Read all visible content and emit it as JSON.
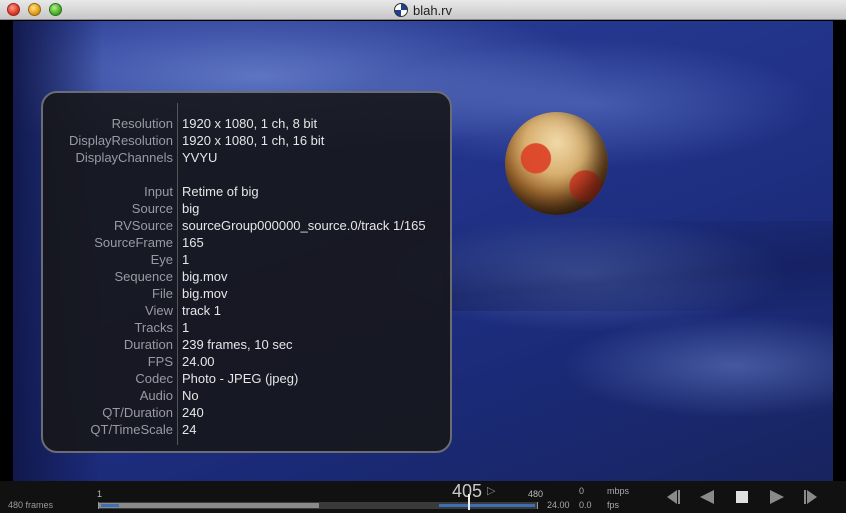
{
  "window": {
    "title": "blah.rv"
  },
  "info": {
    "rows": [
      {
        "label": "Resolution",
        "value": "1920 x 1080, 1 ch, 8 bit"
      },
      {
        "label": "DisplayResolution",
        "value": "1920 x 1080, 1 ch, 16 bit"
      },
      {
        "label": "DisplayChannels",
        "value": "YVYU"
      },
      {
        "label": "Input",
        "value": "Retime of big"
      },
      {
        "label": "Source",
        "value": "big"
      },
      {
        "label": "RVSource",
        "value": "sourceGroup000000_source.0/track 1/165"
      },
      {
        "label": "SourceFrame",
        "value": "165"
      },
      {
        "label": "Eye",
        "value": "1"
      },
      {
        "label": "Sequence",
        "value": "big.mov"
      },
      {
        "label": "File",
        "value": "big.mov"
      },
      {
        "label": "View",
        "value": "track 1"
      },
      {
        "label": "Tracks",
        "value": "1"
      },
      {
        "label": "Duration",
        "value": "239 frames, 10 sec"
      },
      {
        "label": "FPS",
        "value": "24.00"
      },
      {
        "label": "Codec",
        "value": "Photo - JPEG (jpeg)"
      },
      {
        "label": "Audio",
        "value": "No"
      },
      {
        "label": "QT/Duration",
        "value": "240"
      },
      {
        "label": "QT/TimeScale",
        "value": "24"
      }
    ]
  },
  "timeline": {
    "frames_count": "480 frames",
    "start": "1",
    "end": "480",
    "current": "405",
    "current_fraction": 0.8417,
    "cache_fraction": 0.5
  },
  "stats": {
    "mbps_value": "0",
    "mbps_label": "mbps",
    "fps_target": "24.00",
    "fps_value": "0.0",
    "fps_label": "fps"
  },
  "transport": {
    "icons": [
      "skip-start-icon",
      "step-back-icon",
      "stop-icon",
      "play-icon",
      "skip-end-icon"
    ]
  }
}
